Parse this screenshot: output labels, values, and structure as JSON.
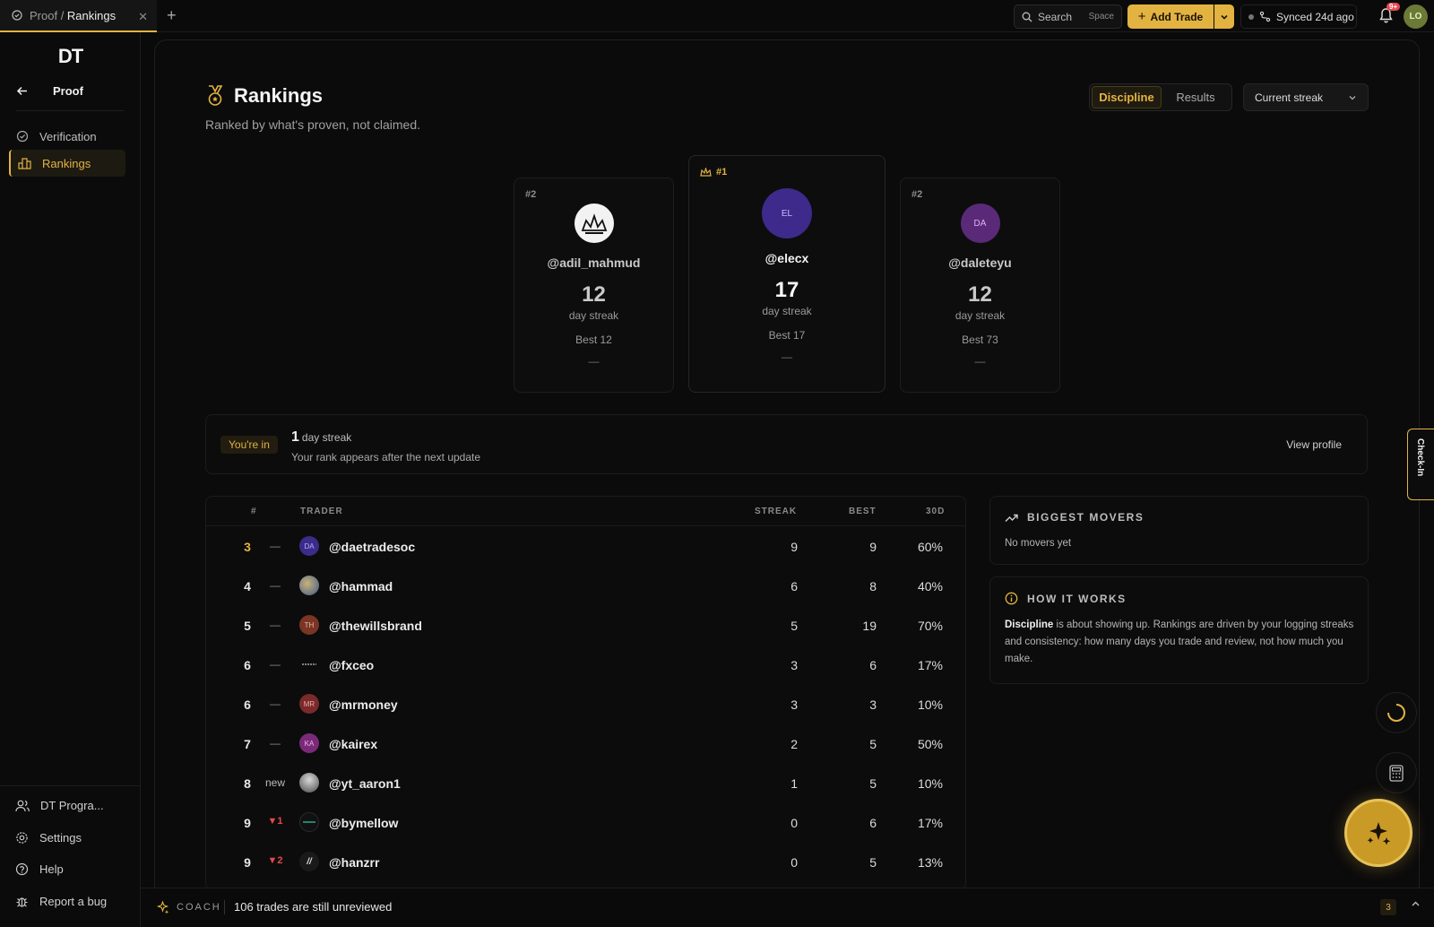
{
  "topbar": {
    "tab_section": "Proof",
    "tab_page": "Rankings",
    "search_label": "Search",
    "search_shortcut": "Space",
    "add_trade_label": "Add Trade",
    "synced_label": "Synced 24d ago",
    "notif_badge": "9+",
    "user_initials": "LO"
  },
  "sidebar": {
    "logo": "DT",
    "back_label": "Proof",
    "items": [
      {
        "label": "Verification"
      },
      {
        "label": "Rankings"
      }
    ],
    "bottom": [
      {
        "label": "DT Progra..."
      },
      {
        "label": "Settings"
      },
      {
        "label": "Help"
      },
      {
        "label": "Report a bug"
      }
    ]
  },
  "header": {
    "title": "Rankings",
    "subtitle": "Ranked by what's proven, not claimed.",
    "segments": [
      "Discipline",
      "Results"
    ],
    "active_segment": "Discipline",
    "sort_select": "Current streak"
  },
  "podium": [
    {
      "rank": "#2",
      "handle": "@adil_mahmud",
      "value": "12",
      "unit": "day streak",
      "best": "Best 12",
      "change": "—"
    },
    {
      "rank": "#1",
      "initials": "EL",
      "handle": "@elecx",
      "value": "17",
      "unit": "day streak",
      "best": "Best 17",
      "change": "—"
    },
    {
      "rank": "#2",
      "initials": "DA",
      "handle": "@daleteyu",
      "value": "12",
      "unit": "day streak",
      "best": "Best 73",
      "change": "—"
    }
  ],
  "you": {
    "pill": "You're in",
    "streak_value": "1",
    "streak_unit": "day streak",
    "hint": "Your rank appears after the next update",
    "view_profile": "View profile"
  },
  "table": {
    "headers": {
      "rank": "#",
      "trader": "TRADER",
      "streak": "STREAK",
      "best": "BEST",
      "d30": "30D"
    },
    "rows": [
      {
        "rank": "3",
        "change": "—",
        "initials": "DA",
        "handle": "@daetradesoc",
        "streak": "9",
        "best": "9",
        "d30": "60%"
      },
      {
        "rank": "4",
        "change": "—",
        "initials": "",
        "handle": "@hammad",
        "streak": "6",
        "best": "8",
        "d30": "40%"
      },
      {
        "rank": "5",
        "change": "—",
        "initials": "TH",
        "handle": "@thewillsbrand",
        "streak": "5",
        "best": "19",
        "d30": "70%"
      },
      {
        "rank": "6",
        "change": "—",
        "initials": "",
        "handle": "@fxceo",
        "streak": "3",
        "best": "6",
        "d30": "17%"
      },
      {
        "rank": "6",
        "change": "—",
        "initials": "MR",
        "handle": "@mrmoney",
        "streak": "3",
        "best": "3",
        "d30": "10%"
      },
      {
        "rank": "7",
        "change": "—",
        "initials": "KA",
        "handle": "@kairex",
        "streak": "2",
        "best": "5",
        "d30": "50%"
      },
      {
        "rank": "8",
        "change": "new",
        "initials": "",
        "handle": "@yt_aaron1",
        "streak": "1",
        "best": "5",
        "d30": "10%"
      },
      {
        "rank": "9",
        "change": "▼1",
        "initials": "",
        "handle": "@bymellow",
        "streak": "0",
        "best": "6",
        "d30": "17%"
      },
      {
        "rank": "9",
        "change": "▼2",
        "initials": "//",
        "handle": "@hanzrr",
        "streak": "0",
        "best": "5",
        "d30": "13%"
      }
    ]
  },
  "movers": {
    "title": "BIGGEST MOVERS",
    "empty": "No movers yet"
  },
  "how": {
    "title": "HOW IT WORKS",
    "strong": "Discipline",
    "body": " is about showing up. Rankings are driven by your logging streaks and consistency: how many days you trade and review, not how much you make."
  },
  "checkin_label": "Check-In",
  "coach": {
    "label": "COACH",
    "message": "106 trades are still unreviewed",
    "count": "3"
  },
  "colors": {
    "accent": "#e3b341",
    "danger": "#e5484d",
    "background": "#0a0a0a"
  }
}
